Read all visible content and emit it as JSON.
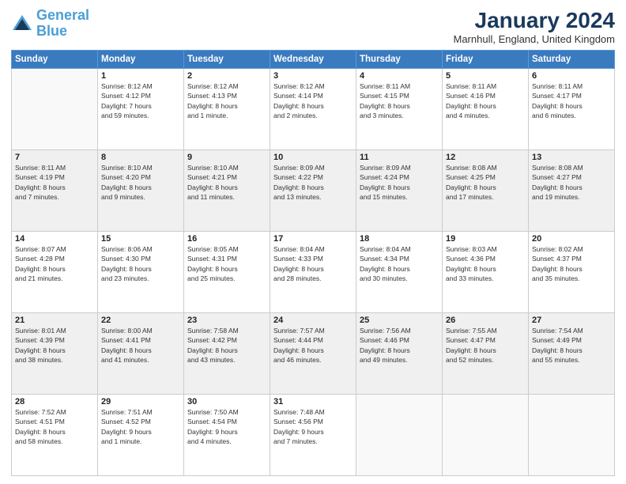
{
  "logo": {
    "line1": "General",
    "line2": "Blue"
  },
  "header": {
    "month": "January 2024",
    "location": "Marnhull, England, United Kingdom"
  },
  "weekdays": [
    "Sunday",
    "Monday",
    "Tuesday",
    "Wednesday",
    "Thursday",
    "Friday",
    "Saturday"
  ],
  "weeks": [
    [
      {
        "day": "",
        "info": ""
      },
      {
        "day": "1",
        "info": "Sunrise: 8:12 AM\nSunset: 4:12 PM\nDaylight: 7 hours\nand 59 minutes."
      },
      {
        "day": "2",
        "info": "Sunrise: 8:12 AM\nSunset: 4:13 PM\nDaylight: 8 hours\nand 1 minute."
      },
      {
        "day": "3",
        "info": "Sunrise: 8:12 AM\nSunset: 4:14 PM\nDaylight: 8 hours\nand 2 minutes."
      },
      {
        "day": "4",
        "info": "Sunrise: 8:11 AM\nSunset: 4:15 PM\nDaylight: 8 hours\nand 3 minutes."
      },
      {
        "day": "5",
        "info": "Sunrise: 8:11 AM\nSunset: 4:16 PM\nDaylight: 8 hours\nand 4 minutes."
      },
      {
        "day": "6",
        "info": "Sunrise: 8:11 AM\nSunset: 4:17 PM\nDaylight: 8 hours\nand 6 minutes."
      }
    ],
    [
      {
        "day": "7",
        "info": "Sunrise: 8:11 AM\nSunset: 4:19 PM\nDaylight: 8 hours\nand 7 minutes."
      },
      {
        "day": "8",
        "info": "Sunrise: 8:10 AM\nSunset: 4:20 PM\nDaylight: 8 hours\nand 9 minutes."
      },
      {
        "day": "9",
        "info": "Sunrise: 8:10 AM\nSunset: 4:21 PM\nDaylight: 8 hours\nand 11 minutes."
      },
      {
        "day": "10",
        "info": "Sunrise: 8:09 AM\nSunset: 4:22 PM\nDaylight: 8 hours\nand 13 minutes."
      },
      {
        "day": "11",
        "info": "Sunrise: 8:09 AM\nSunset: 4:24 PM\nDaylight: 8 hours\nand 15 minutes."
      },
      {
        "day": "12",
        "info": "Sunrise: 8:08 AM\nSunset: 4:25 PM\nDaylight: 8 hours\nand 17 minutes."
      },
      {
        "day": "13",
        "info": "Sunrise: 8:08 AM\nSunset: 4:27 PM\nDaylight: 8 hours\nand 19 minutes."
      }
    ],
    [
      {
        "day": "14",
        "info": "Sunrise: 8:07 AM\nSunset: 4:28 PM\nDaylight: 8 hours\nand 21 minutes."
      },
      {
        "day": "15",
        "info": "Sunrise: 8:06 AM\nSunset: 4:30 PM\nDaylight: 8 hours\nand 23 minutes."
      },
      {
        "day": "16",
        "info": "Sunrise: 8:05 AM\nSunset: 4:31 PM\nDaylight: 8 hours\nand 25 minutes."
      },
      {
        "day": "17",
        "info": "Sunrise: 8:04 AM\nSunset: 4:33 PM\nDaylight: 8 hours\nand 28 minutes."
      },
      {
        "day": "18",
        "info": "Sunrise: 8:04 AM\nSunset: 4:34 PM\nDaylight: 8 hours\nand 30 minutes."
      },
      {
        "day": "19",
        "info": "Sunrise: 8:03 AM\nSunset: 4:36 PM\nDaylight: 8 hours\nand 33 minutes."
      },
      {
        "day": "20",
        "info": "Sunrise: 8:02 AM\nSunset: 4:37 PM\nDaylight: 8 hours\nand 35 minutes."
      }
    ],
    [
      {
        "day": "21",
        "info": "Sunrise: 8:01 AM\nSunset: 4:39 PM\nDaylight: 8 hours\nand 38 minutes."
      },
      {
        "day": "22",
        "info": "Sunrise: 8:00 AM\nSunset: 4:41 PM\nDaylight: 8 hours\nand 41 minutes."
      },
      {
        "day": "23",
        "info": "Sunrise: 7:58 AM\nSunset: 4:42 PM\nDaylight: 8 hours\nand 43 minutes."
      },
      {
        "day": "24",
        "info": "Sunrise: 7:57 AM\nSunset: 4:44 PM\nDaylight: 8 hours\nand 46 minutes."
      },
      {
        "day": "25",
        "info": "Sunrise: 7:56 AM\nSunset: 4:46 PM\nDaylight: 8 hours\nand 49 minutes."
      },
      {
        "day": "26",
        "info": "Sunrise: 7:55 AM\nSunset: 4:47 PM\nDaylight: 8 hours\nand 52 minutes."
      },
      {
        "day": "27",
        "info": "Sunrise: 7:54 AM\nSunset: 4:49 PM\nDaylight: 8 hours\nand 55 minutes."
      }
    ],
    [
      {
        "day": "28",
        "info": "Sunrise: 7:52 AM\nSunset: 4:51 PM\nDaylight: 8 hours\nand 58 minutes."
      },
      {
        "day": "29",
        "info": "Sunrise: 7:51 AM\nSunset: 4:52 PM\nDaylight: 9 hours\nand 1 minute."
      },
      {
        "day": "30",
        "info": "Sunrise: 7:50 AM\nSunset: 4:54 PM\nDaylight: 9 hours\nand 4 minutes."
      },
      {
        "day": "31",
        "info": "Sunrise: 7:48 AM\nSunset: 4:56 PM\nDaylight: 9 hours\nand 7 minutes."
      },
      {
        "day": "",
        "info": ""
      },
      {
        "day": "",
        "info": ""
      },
      {
        "day": "",
        "info": ""
      }
    ]
  ]
}
